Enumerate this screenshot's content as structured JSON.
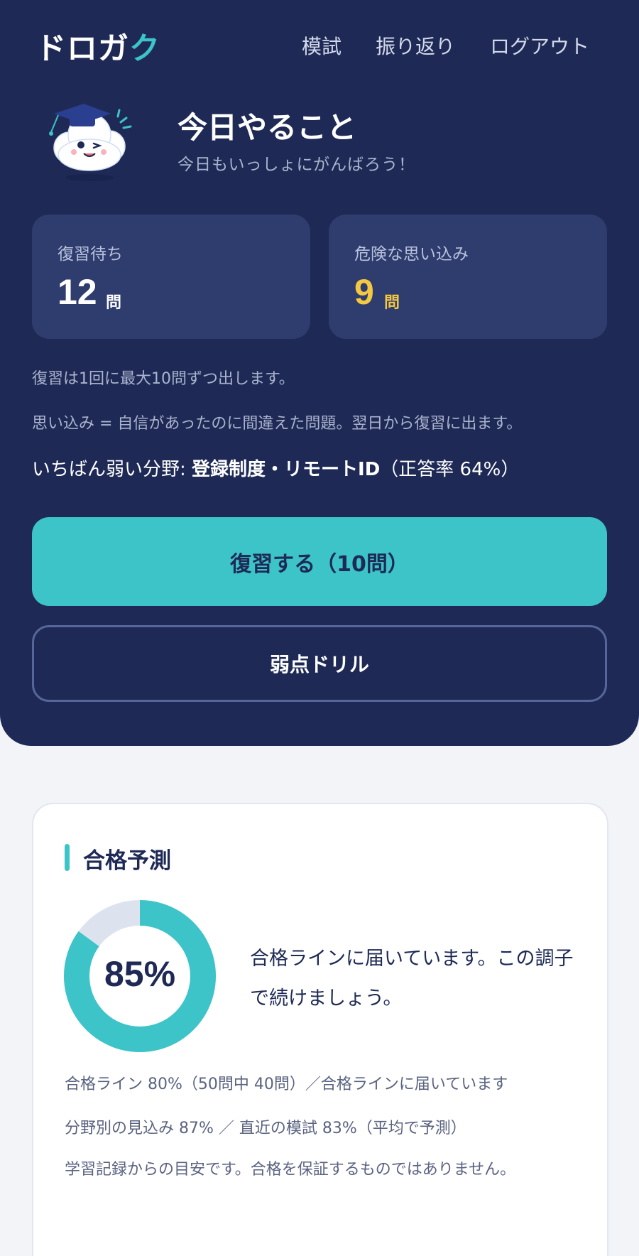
{
  "header": {
    "logo_main": "ドロガ",
    "logo_accent": "ク",
    "nav": [
      "模試",
      "振り返り",
      "ログアウト"
    ]
  },
  "today": {
    "title": "今日やること",
    "subtitle": "今日もいっしょにがんばろう！",
    "mascot_icon": "cloud-graduate-mascot"
  },
  "stats": {
    "review_label": "復習待ち",
    "review_count": "12",
    "review_unit": "問",
    "danger_label": "危険な思い込み",
    "danger_count": "9",
    "danger_unit": "問"
  },
  "notes": {
    "review_limit": "復習は1回に最大10問ずつ出します。",
    "misconception_def": "思い込み = 自信があったのに間違えた問題。翌日から復習に出ます。",
    "weak_prefix": "いちばん弱い分野: ",
    "weak_field": "登録制度・リモートID",
    "weak_rate": "（正答率 64%）"
  },
  "buttons": {
    "review": "復習する（10問）",
    "drill": "弱点ドリル"
  },
  "prediction": {
    "title": "合格予測",
    "percent_label": "85%",
    "percent": 85,
    "message": "合格ラインに届いています。この調子で続けましょう。",
    "line1": "合格ライン 80%（50問中 40問）／合格ラインに届いています",
    "line2": "分野別の見込み 87% ／ 直近の模試 83%（平均で予測）",
    "disclaimer": "学習記録からの目安です。合格を保証するものではありません。"
  },
  "colors": {
    "navy": "#1e2a55",
    "accent": "#3cc4c8",
    "warning": "#f5c842",
    "card": "#2e3c6e"
  }
}
